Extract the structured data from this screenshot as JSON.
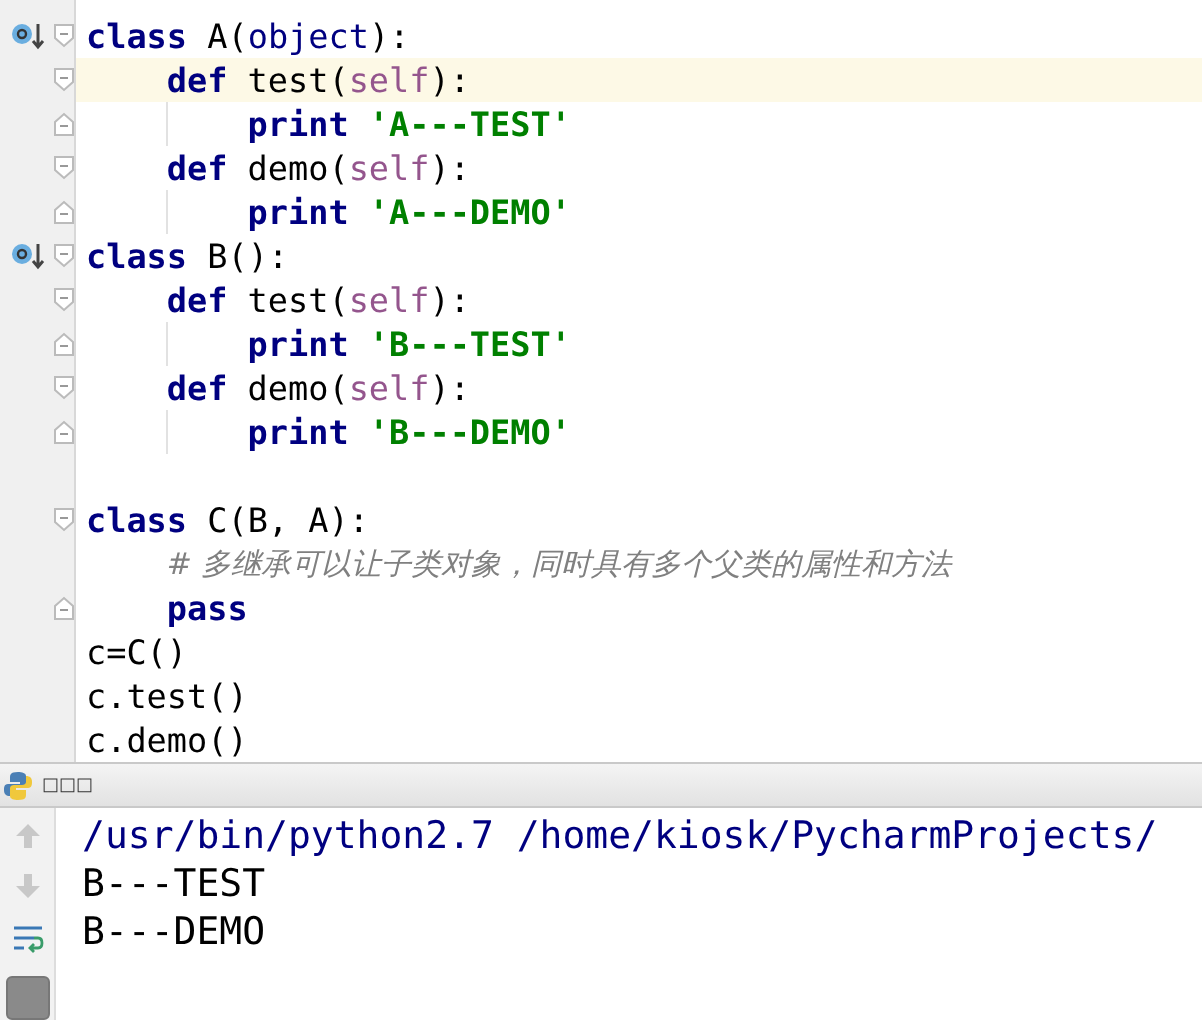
{
  "editor": {
    "lines": [
      {
        "overridden": true,
        "fold_start": true,
        "current": false,
        "tokens": [
          {
            "kind": "keyword",
            "text": "class"
          },
          {
            "kind": "plain",
            "text": " A("
          },
          {
            "kind": "builtin",
            "text": "object"
          },
          {
            "kind": "plain",
            "text": "):"
          }
        ],
        "children": [
          {
            "fold_start": true,
            "current": true,
            "tokens": [
              {
                "kind": "keyword",
                "text": "def"
              },
              {
                "kind": "plain",
                "text": " test("
              },
              {
                "kind": "self",
                "text": "self"
              },
              {
                "kind": "plain",
                "text": "):"
              }
            ],
            "children": [
              {
                "fold_end": true,
                "current": false,
                "tokens": [
                  {
                    "kind": "keyword",
                    "text": "print"
                  },
                  {
                    "kind": "string",
                    "text": " 'A---TEST'"
                  }
                ]
              }
            ]
          },
          {
            "fold_start": true,
            "current": false,
            "tokens": [
              {
                "kind": "keyword",
                "text": "def"
              },
              {
                "kind": "plain",
                "text": " demo("
              },
              {
                "kind": "self",
                "text": "self"
              },
              {
                "kind": "plain",
                "text": "):"
              }
            ],
            "children": [
              {
                "fold_end": true,
                "current": false,
                "tokens": [
                  {
                    "kind": "keyword",
                    "text": "print"
                  },
                  {
                    "kind": "string",
                    "text": " 'A---DEMO'"
                  }
                ]
              }
            ]
          }
        ]
      },
      {
        "overridden": true,
        "fold_start": true,
        "current": false,
        "tokens": [
          {
            "kind": "keyword",
            "text": "class"
          },
          {
            "kind": "plain",
            "text": " B():"
          }
        ],
        "children": [
          {
            "fold_start": true,
            "current": false,
            "tokens": [
              {
                "kind": "keyword",
                "text": "def"
              },
              {
                "kind": "plain",
                "text": " test("
              },
              {
                "kind": "self",
                "text": "self"
              },
              {
                "kind": "plain",
                "text": "):"
              }
            ],
            "children": [
              {
                "fold_end": true,
                "current": false,
                "tokens": [
                  {
                    "kind": "keyword",
                    "text": "print"
                  },
                  {
                    "kind": "string",
                    "text": " 'B---TEST'"
                  }
                ]
              }
            ]
          },
          {
            "fold_start": true,
            "current": false,
            "tokens": [
              {
                "kind": "keyword",
                "text": "def"
              },
              {
                "kind": "plain",
                "text": " demo("
              },
              {
                "kind": "self",
                "text": "self"
              },
              {
                "kind": "plain",
                "text": "):"
              }
            ],
            "children": [
              {
                "fold_end": true,
                "current": false,
                "tokens": [
                  {
                    "kind": "keyword",
                    "text": "print"
                  },
                  {
                    "kind": "string",
                    "text": " 'B---DEMO'"
                  }
                ]
              }
            ]
          }
        ]
      },
      {
        "current": false
      },
      {
        "fold_start": true,
        "current": false,
        "tokens": [
          {
            "kind": "keyword",
            "text": "class"
          },
          {
            "kind": "plain",
            "text": " C(B, A):"
          }
        ],
        "children": [
          {
            "current": false,
            "tokens": [
              {
                "kind": "comment",
                "text": "# 多继承可以让子类对象，同时具有多个父类的属性和方法"
              }
            ]
          },
          {
            "fold_end": true,
            "current": false,
            "tokens": [
              {
                "kind": "keyword",
                "text": "pass"
              }
            ]
          }
        ]
      },
      {
        "current": false,
        "tokens": [
          {
            "kind": "plain",
            "text": "c=C()"
          }
        ]
      },
      {
        "current": false,
        "tokens": [
          {
            "kind": "plain",
            "text": "c.test()"
          }
        ]
      },
      {
        "current": false,
        "tokens": [
          {
            "kind": "plain",
            "text": "c.demo()"
          }
        ]
      }
    ]
  },
  "run_panel": {
    "title": "□□□",
    "console": [
      {
        "kind": "command",
        "text": "/usr/bin/python2.7 /home/kiosk/PycharmProjects/"
      },
      {
        "kind": "output",
        "text": "B---TEST"
      },
      {
        "kind": "output",
        "text": "B---DEMO"
      }
    ]
  }
}
